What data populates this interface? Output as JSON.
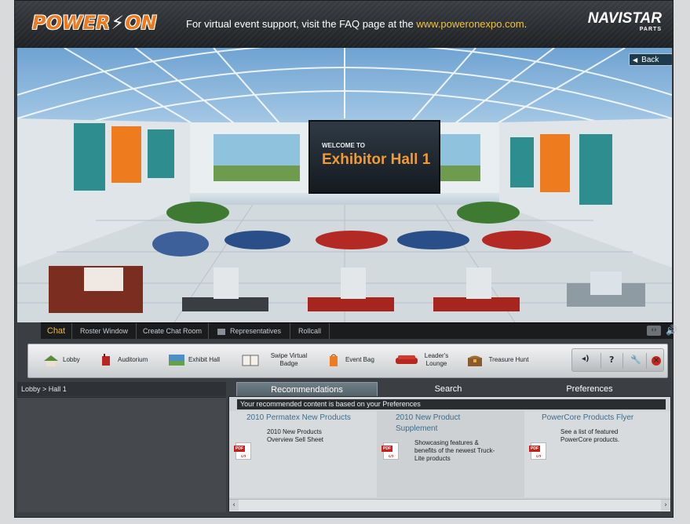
{
  "header": {
    "logo_left": "POWER",
    "logo_bolt": "⚡",
    "logo_right": "ON",
    "message_prefix": "For virtual event support, visit the FAQ page at the ",
    "message_url": "www.poweronexpo.com",
    "message_suffix": ".",
    "brand_name": "NAVISTAR",
    "brand_sub": "PARTS"
  },
  "scene": {
    "back_label": "Back",
    "welcome_line": "WELCOME TO",
    "welcome_title": "Exhibitor Hall 1"
  },
  "chat_tabs": [
    {
      "label": "Chat"
    },
    {
      "label": "Roster Window"
    },
    {
      "label": "Create Chat Room"
    },
    {
      "label": "Representatives"
    },
    {
      "label": "Rollcall"
    }
  ],
  "toolbar": {
    "items": [
      {
        "label": "Lobby",
        "icon": "lobby-icon"
      },
      {
        "label": "Auditorium",
        "icon": "auditorium-icon"
      },
      {
        "label": "Exhibit Hall",
        "icon": "exhibit-hall-icon"
      },
      {
        "label": "Swipe Virtual Badge",
        "icon": "badge-book-icon"
      },
      {
        "label": "Event Bag",
        "icon": "event-bag-icon"
      },
      {
        "label": "Leader's Lounge",
        "icon": "sofa-icon"
      },
      {
        "label": "Treasure Hunt",
        "icon": "treasure-chest-icon"
      }
    ],
    "help_label": "?"
  },
  "breadcrumb": {
    "root": "Lobby",
    "separator": " > ",
    "current": "Hall 1"
  },
  "tabs": [
    {
      "label": "Recommendations",
      "active": true
    },
    {
      "label": "Search",
      "active": false
    },
    {
      "label": "Preferences",
      "active": false
    }
  ],
  "recommendations": {
    "notice": "Your recommended content is based on your Preferences",
    "cards": [
      {
        "title": "2010 Permatex New Products",
        "desc": "2010 New Products Overview Sell Sheet"
      },
      {
        "title": "2010 New Product Supplement",
        "desc": "Showcasing features & benefits of the newest Truck-Lite products"
      },
      {
        "title": "PowerCore Products Flyer",
        "desc": "See a list of featured PowerCore products."
      }
    ],
    "pdf_label": "PDF"
  },
  "colors": {
    "accent_orange": "#f29a30",
    "header_link": "#f0c33c",
    "active_chat_tab": "#f0b73a",
    "close_red": "#c9261c"
  }
}
